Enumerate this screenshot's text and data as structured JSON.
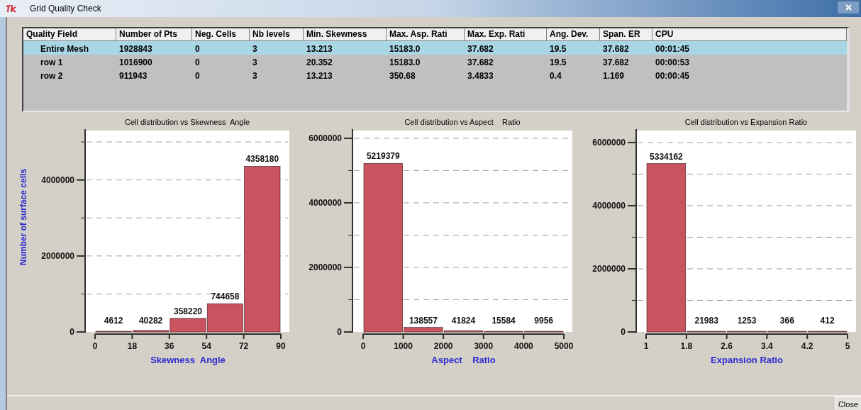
{
  "window": {
    "title": "Grid Quality Check"
  },
  "table": {
    "columns": [
      "Quality Field",
      "Number of Pts",
      "Neg. Cells",
      "Nb levels",
      "Min. Skewness",
      "Max. Asp. Rati",
      "Max. Exp. Rati",
      "Ang. Dev.",
      "Span. ER",
      "CPU"
    ],
    "rows": [
      {
        "cells": [
          "Entire Mesh",
          "1928843",
          "0",
          "3",
          "13.213",
          "15183.0",
          "37.682",
          "19.5",
          "37.682",
          "00:01:45"
        ],
        "selected": true
      },
      {
        "cells": [
          "row 1",
          "1016900",
          "0",
          "3",
          "20.352",
          "15183.0",
          "37.682",
          "19.5",
          "37.682",
          "00:00:53"
        ],
        "selected": false
      },
      {
        "cells": [
          "row 2",
          "911943",
          "0",
          "3",
          "13.213",
          "350.68",
          "3.4833",
          "0.4",
          "1.169",
          "00:00:45"
        ],
        "selected": false
      }
    ]
  },
  "charts": [
    {
      "chart_data": {
        "type": "bar",
        "title": "Cell distribution vs Skewness  Angle",
        "xlabel": "Skewness  Angle",
        "ylabel": "Number of surface cells",
        "x": [
          9,
          27,
          45,
          63,
          81
        ],
        "xlim": [
          0,
          90
        ],
        "ylim": [
          0,
          5300000
        ],
        "xticks": [
          0,
          18,
          36,
          54,
          72,
          90
        ],
        "yticks": [
          0,
          2000000,
          4000000
        ],
        "values": [
          4612,
          40282,
          358220,
          744658,
          4358180
        ],
        "grid": true,
        "data_labels": true
      }
    },
    {
      "chart_data": {
        "type": "bar",
        "title": "Cell distribution vs Aspect    Ratio",
        "xlabel": "Aspect    Ratio",
        "x": [
          500,
          1500,
          2500,
          3500,
          4500
        ],
        "xlim": [
          0,
          5000
        ],
        "ylim": [
          0,
          6240000
        ],
        "xticks": [
          0,
          1000,
          2000,
          3000,
          4000,
          5000
        ],
        "yticks": [
          0,
          2000000,
          4000000,
          6000000
        ],
        "values": [
          5219379,
          138557,
          41824,
          15584,
          9956
        ],
        "grid": true,
        "data_labels": true
      }
    },
    {
      "chart_data": {
        "type": "bar",
        "title": "Cell distribution vs Expansion Ratio",
        "xlabel": "Expansion Ratio",
        "x": [
          1.4,
          2.2,
          3,
          3.8,
          4.6
        ],
        "xlim": [
          1,
          5
        ],
        "ylim": [
          0,
          6380000
        ],
        "xticks": [
          1,
          1.8,
          2.6,
          3.4,
          4.2,
          5
        ],
        "yticks": [
          0,
          2000000,
          4000000,
          6000000
        ],
        "values": [
          5334162,
          21983,
          1253,
          366,
          412
        ],
        "grid": true,
        "data_labels": true
      }
    }
  ],
  "buttons": [
    {
      "label": "Close"
    }
  ]
}
